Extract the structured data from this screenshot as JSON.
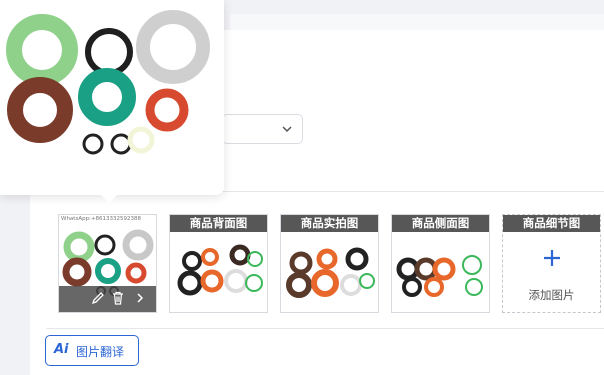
{
  "gallery": {
    "main_image": {
      "watermark": "WhatsApp:+8613332592388",
      "actions": [
        "edit-icon",
        "delete-icon",
        "next-icon"
      ]
    },
    "tiles": [
      {
        "label": "商品背面图"
      },
      {
        "label": "商品实拍图"
      },
      {
        "label": "商品侧面图"
      }
    ],
    "add_tile": {
      "label": "商品细节图",
      "action_label": "添加图片"
    }
  },
  "translate_button": {
    "icon_text": "Ai",
    "label": "图片翻译"
  },
  "colors": {
    "accent": "#2c66d6",
    "ring_green": "#8fd18a",
    "ring_brown": "#7a3b2a",
    "ring_teal": "#1aa085",
    "ring_red": "#d84a2f"
  }
}
